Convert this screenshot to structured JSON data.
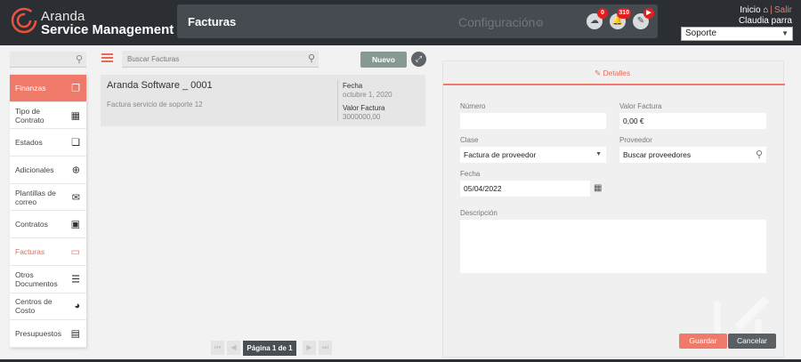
{
  "brand": {
    "line1": "Aranda",
    "line2": "Service Management",
    "accent": "#e8533f"
  },
  "header": {
    "module_title": "Facturas",
    "config_label": "Configuración",
    "icons": [
      {
        "name": "cloud-download-icon",
        "badge": "0"
      },
      {
        "name": "bell-icon",
        "badge": "310"
      },
      {
        "name": "tools-icon",
        "badge": "▶"
      }
    ],
    "inicio_label": "Inicio",
    "salir_label": "Salir",
    "user_name": "Claudia parra",
    "project": "Soporte"
  },
  "sidebar": {
    "items": [
      {
        "label": "Finanzas",
        "icon": "stack-icon"
      },
      {
        "label": "Tipo de Contrato",
        "icon": "grid-icon"
      },
      {
        "label": "Estados",
        "icon": "copy-icon"
      },
      {
        "label": "Adicionales",
        "icon": "plus-circle-icon"
      },
      {
        "label": "Plantillas de correo",
        "icon": "mail-icon"
      },
      {
        "label": "Contratos",
        "icon": "contract-icon"
      },
      {
        "label": "Facturas",
        "icon": "invoice-icon"
      },
      {
        "label": "Otros Documentos",
        "icon": "document-icon"
      },
      {
        "label": "Centros de Costo",
        "icon": "pie-icon"
      },
      {
        "label": "Presupuestos",
        "icon": "money-icon"
      }
    ]
  },
  "list": {
    "search_placeholder": "Buscar Facturas",
    "new_button": "Nuevo",
    "items": [
      {
        "title": "Aranda Software _ 0001",
        "description": "Factura servicio de soporte 12",
        "fecha_label": "Fecha",
        "fecha_value": "octubre 1, 2020",
        "valor_label": "Valor Factura",
        "valor_value": "3000000,00"
      }
    ],
    "pager_label": "Página 1 de 1"
  },
  "detail": {
    "tab_label": "Detalles",
    "numero_label": "Número",
    "numero_value": "",
    "valor_label": "Valor Factura",
    "valor_value": "0,00 €",
    "clase_label": "Clase",
    "clase_value": "Factura de proveedor",
    "proveedor_label": "Proveedor",
    "proveedor_value": "Buscar proveedores",
    "fecha_label": "Fecha",
    "fecha_value": "05/04/2022",
    "descripcion_label": "Descripción",
    "descripcion_value": "",
    "save_button": "Guardar",
    "cancel_button": "Cancelar"
  }
}
